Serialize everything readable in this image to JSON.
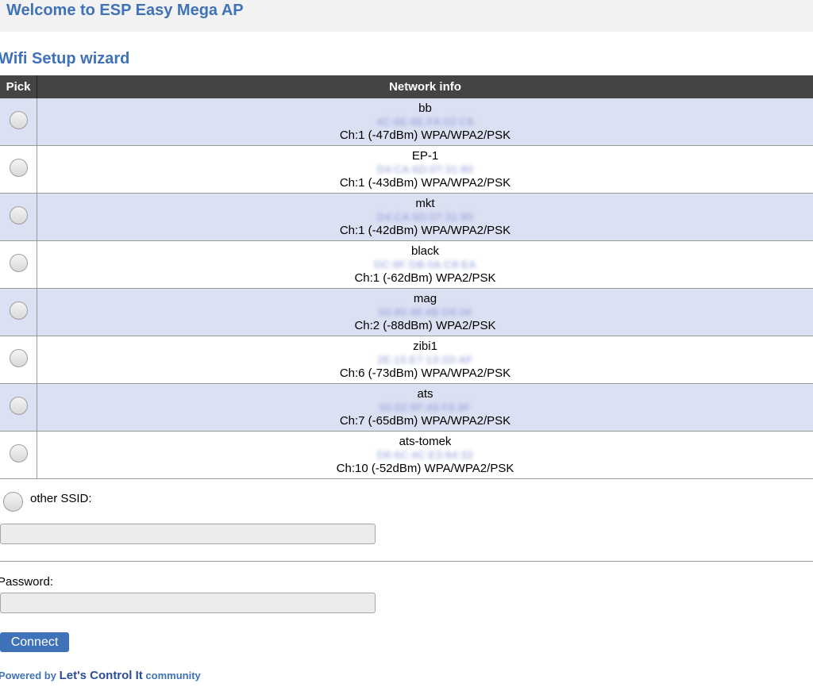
{
  "header": {
    "title": "Welcome to ESP Easy Mega AP"
  },
  "wizard": {
    "title": "Wifi Setup wizard"
  },
  "table": {
    "headers": {
      "pick": "Pick",
      "info": "Network info"
    },
    "networks": [
      {
        "ssid": "bb",
        "mac": "4C:6E:6E:FA:02:C8",
        "details": "Ch:1 (-47dBm) WPA/WPA2/PSK"
      },
      {
        "ssid": "EP-1",
        "mac": "D4:CA:6D:07:31:80",
        "details": "Ch:1 (-43dBm) WPA/WPA2/PSK"
      },
      {
        "ssid": "mkt",
        "mac": "D4:CA:6D:07:31:80",
        "details": "Ch:1 (-42dBm) WPA/WPA2/PSK"
      },
      {
        "ssid": "black",
        "mac": "DC:9F:DB:0A:C8:EA",
        "details": "Ch:1 (-62dBm) WPA2/PSK"
      },
      {
        "ssid": "mag",
        "mac": "00:80:48:4B:D9:06",
        "details": "Ch:2 (-88dBm) WPA2/PSK"
      },
      {
        "ssid": "zibi1",
        "mac": "2E:15:E7:13:2D:AF",
        "details": "Ch:6 (-73dBm) WPA/WPA2/PSK"
      },
      {
        "ssid": "ats",
        "mac": "00:02:6F:49:F6:9F",
        "details": "Ch:7 (-65dBm) WPA/WPA2/PSK"
      },
      {
        "ssid": "ats-tomek",
        "mac": "D8:6C:4C:E3:84:32",
        "details": "Ch:10 (-52dBm) WPA/WPA2/PSK"
      }
    ]
  },
  "other": {
    "label": "other SSID:",
    "value": ""
  },
  "password": {
    "label": "Password:",
    "value": ""
  },
  "connect": {
    "label": "Connect"
  },
  "footer": {
    "prefix": "Powered by ",
    "brand": "Let's Control It",
    "suffix": " community"
  }
}
